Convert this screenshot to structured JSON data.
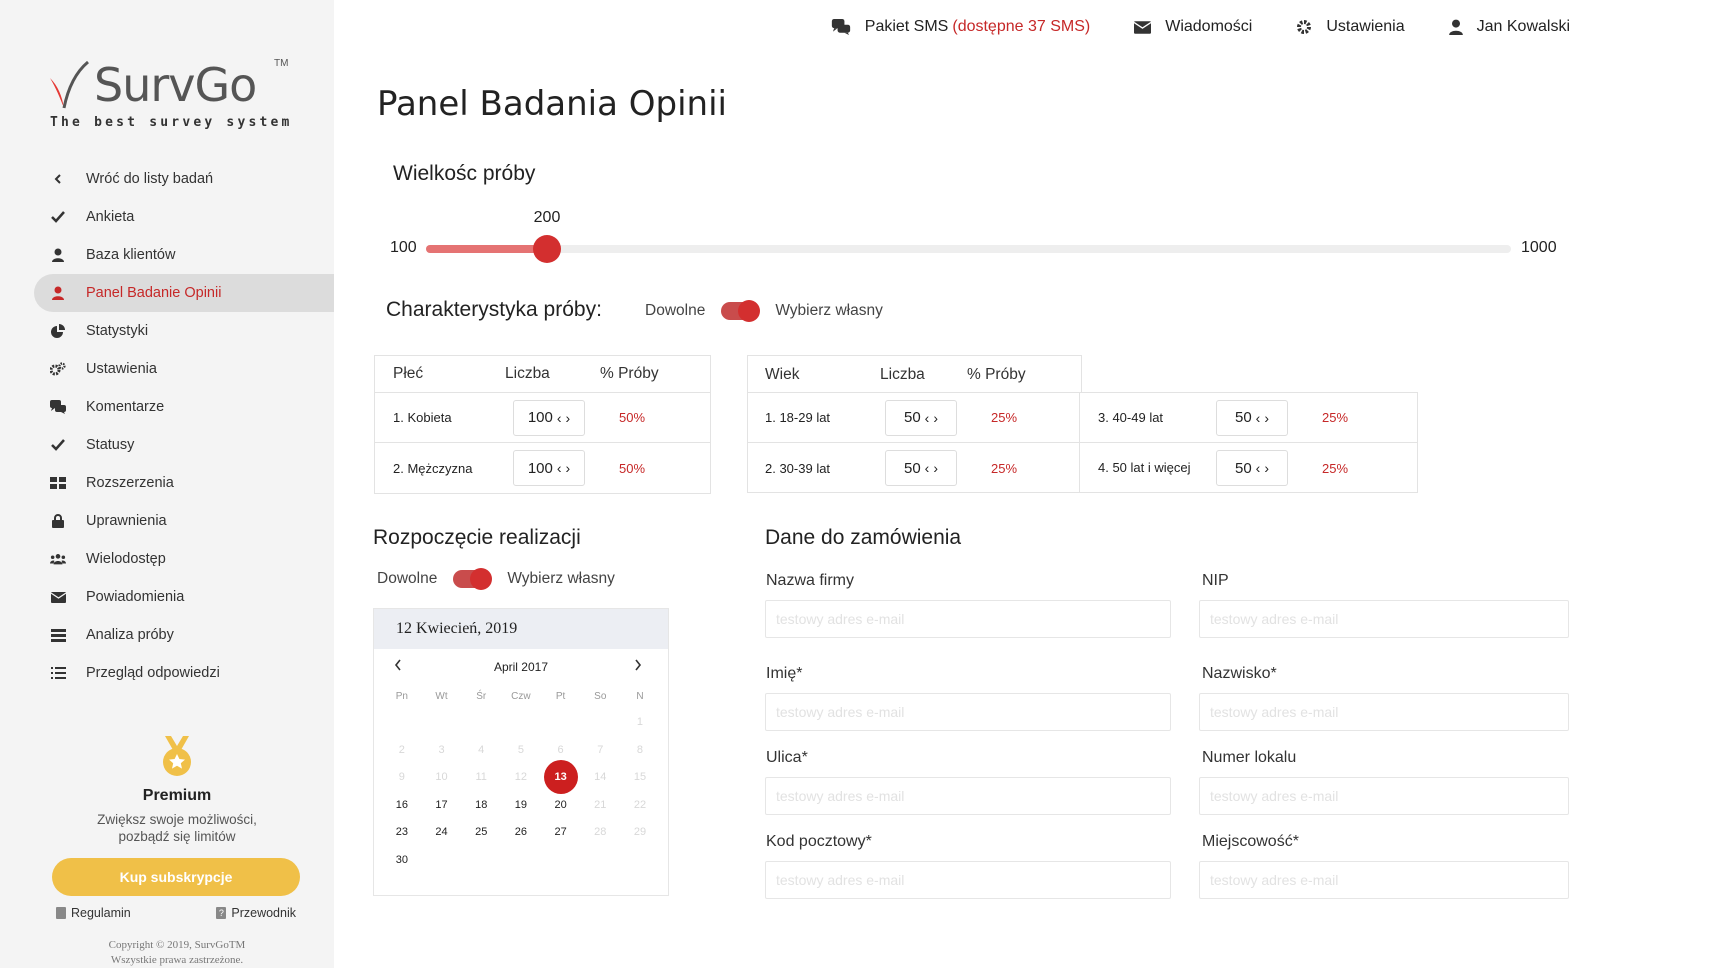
{
  "logo": {
    "brand": "SurvGo",
    "tm": "TM",
    "tagline": "The best survey system"
  },
  "sidebar": {
    "items": [
      {
        "label": "Wróć do listy badań",
        "icon": "chevron-left-icon"
      },
      {
        "label": "Ankieta",
        "icon": "check-icon"
      },
      {
        "label": "Baza klientów",
        "icon": "user-icon"
      },
      {
        "label": "Panel Badanie Opinii",
        "icon": "user-icon",
        "active": true
      },
      {
        "label": "Statystyki",
        "icon": "pie-chart-icon"
      },
      {
        "label": "Ustawienia",
        "icon": "gears-icon"
      },
      {
        "label": "Komentarze",
        "icon": "comments-icon"
      },
      {
        "label": "Statusy",
        "icon": "check-icon"
      },
      {
        "label": "Rozszerzenia",
        "icon": "grid-icon"
      },
      {
        "label": "Uprawnienia",
        "icon": "lock-icon"
      },
      {
        "label": "Wielodostęp",
        "icon": "users-icon"
      },
      {
        "label": "Powiadomienia",
        "icon": "envelope-icon"
      },
      {
        "label": "Analiza próby",
        "icon": "server-icon"
      },
      {
        "label": "Przegląd odpowiedzi",
        "icon": "list-icon"
      }
    ],
    "premium": {
      "title": "Premium",
      "desc_line1": "Zwiększ swoje możliwości,",
      "desc_line2": "pozbądź się limitów",
      "button": "Kup subskrypcje"
    },
    "links": {
      "terms": "Regulamin",
      "guide": "Przewodnik"
    },
    "copyright_line1": "Copyright © 2019, SurvGoTM",
    "copyright_line2": "Wszystkie prawa zastrzeżone."
  },
  "header": {
    "sms_label": "Pakiet SMS",
    "sms_extra": "(dostępne 37 SMS)",
    "messages": "Wiadomości",
    "settings": "Ustawienia",
    "user": "Jan Kowalski"
  },
  "page_title": "Panel Badania Opinii",
  "sample_size": {
    "title": "Wielkośc próby",
    "min": 100,
    "max": 1000,
    "value": 200
  },
  "characteristics": {
    "title": "Charakterystyka próby:",
    "option_any": "Dowolne",
    "option_custom": "Wybierz własny",
    "selected": "Wybierz własny"
  },
  "gender_table": {
    "headers": [
      "Płeć",
      "Liczba",
      "% Próby"
    ],
    "rows": [
      {
        "label": "1. Kobieta",
        "count": "100",
        "pct": "50%"
      },
      {
        "label": "2. Mężczyzna",
        "count": "100",
        "pct": "50%"
      }
    ]
  },
  "age_table": {
    "headers": [
      "Wiek",
      "Liczba",
      "% Próby"
    ],
    "rows": [
      {
        "label": "1. 18-29 lat",
        "count": "50",
        "pct": "25%"
      },
      {
        "label": "2. 30-39 lat",
        "count": "50",
        "pct": "25%"
      },
      {
        "label": "3. 40-49 lat",
        "count": "50",
        "pct": "25%"
      },
      {
        "label": "4. 50 lat i więcej",
        "count": "50",
        "pct": "25%"
      }
    ]
  },
  "start": {
    "title": "Rozpoczęcie realizacji",
    "option_any": "Dowolne",
    "option_custom": "Wybierz własny",
    "selected_date": "12 Kwiecień, 2019",
    "calendar_month": "April 2017",
    "weekdays": [
      "Pn",
      "Wt",
      "Śr",
      "Czw",
      "Pt",
      "So",
      "N"
    ],
    "selected_day": "13"
  },
  "order": {
    "title": "Dane do zamówienia",
    "fields": [
      {
        "label": "Nazwa firmy",
        "placeholder": "testowy adres e-mail"
      },
      {
        "label": "NIP",
        "placeholder": "testowy adres e-mail"
      },
      {
        "label": "Imię*",
        "placeholder": "testowy adres e-mail"
      },
      {
        "label": "Nazwisko*",
        "placeholder": "testowy adres e-mail"
      },
      {
        "label": "Ulica*",
        "placeholder": "testowy adres e-mail"
      },
      {
        "label": "Numer lokalu",
        "placeholder": "testowy adres e-mail"
      },
      {
        "label": "Kod pocztowy*",
        "placeholder": "testowy adres e-mail"
      },
      {
        "label": "Miejscowość*",
        "placeholder": "testowy adres e-mail"
      }
    ]
  },
  "colors": {
    "accent": "#d32f2f",
    "accent_light": "#e57373",
    "premium_button": "#f0c048",
    "sidebar_bg": "#f4f4f4"
  }
}
